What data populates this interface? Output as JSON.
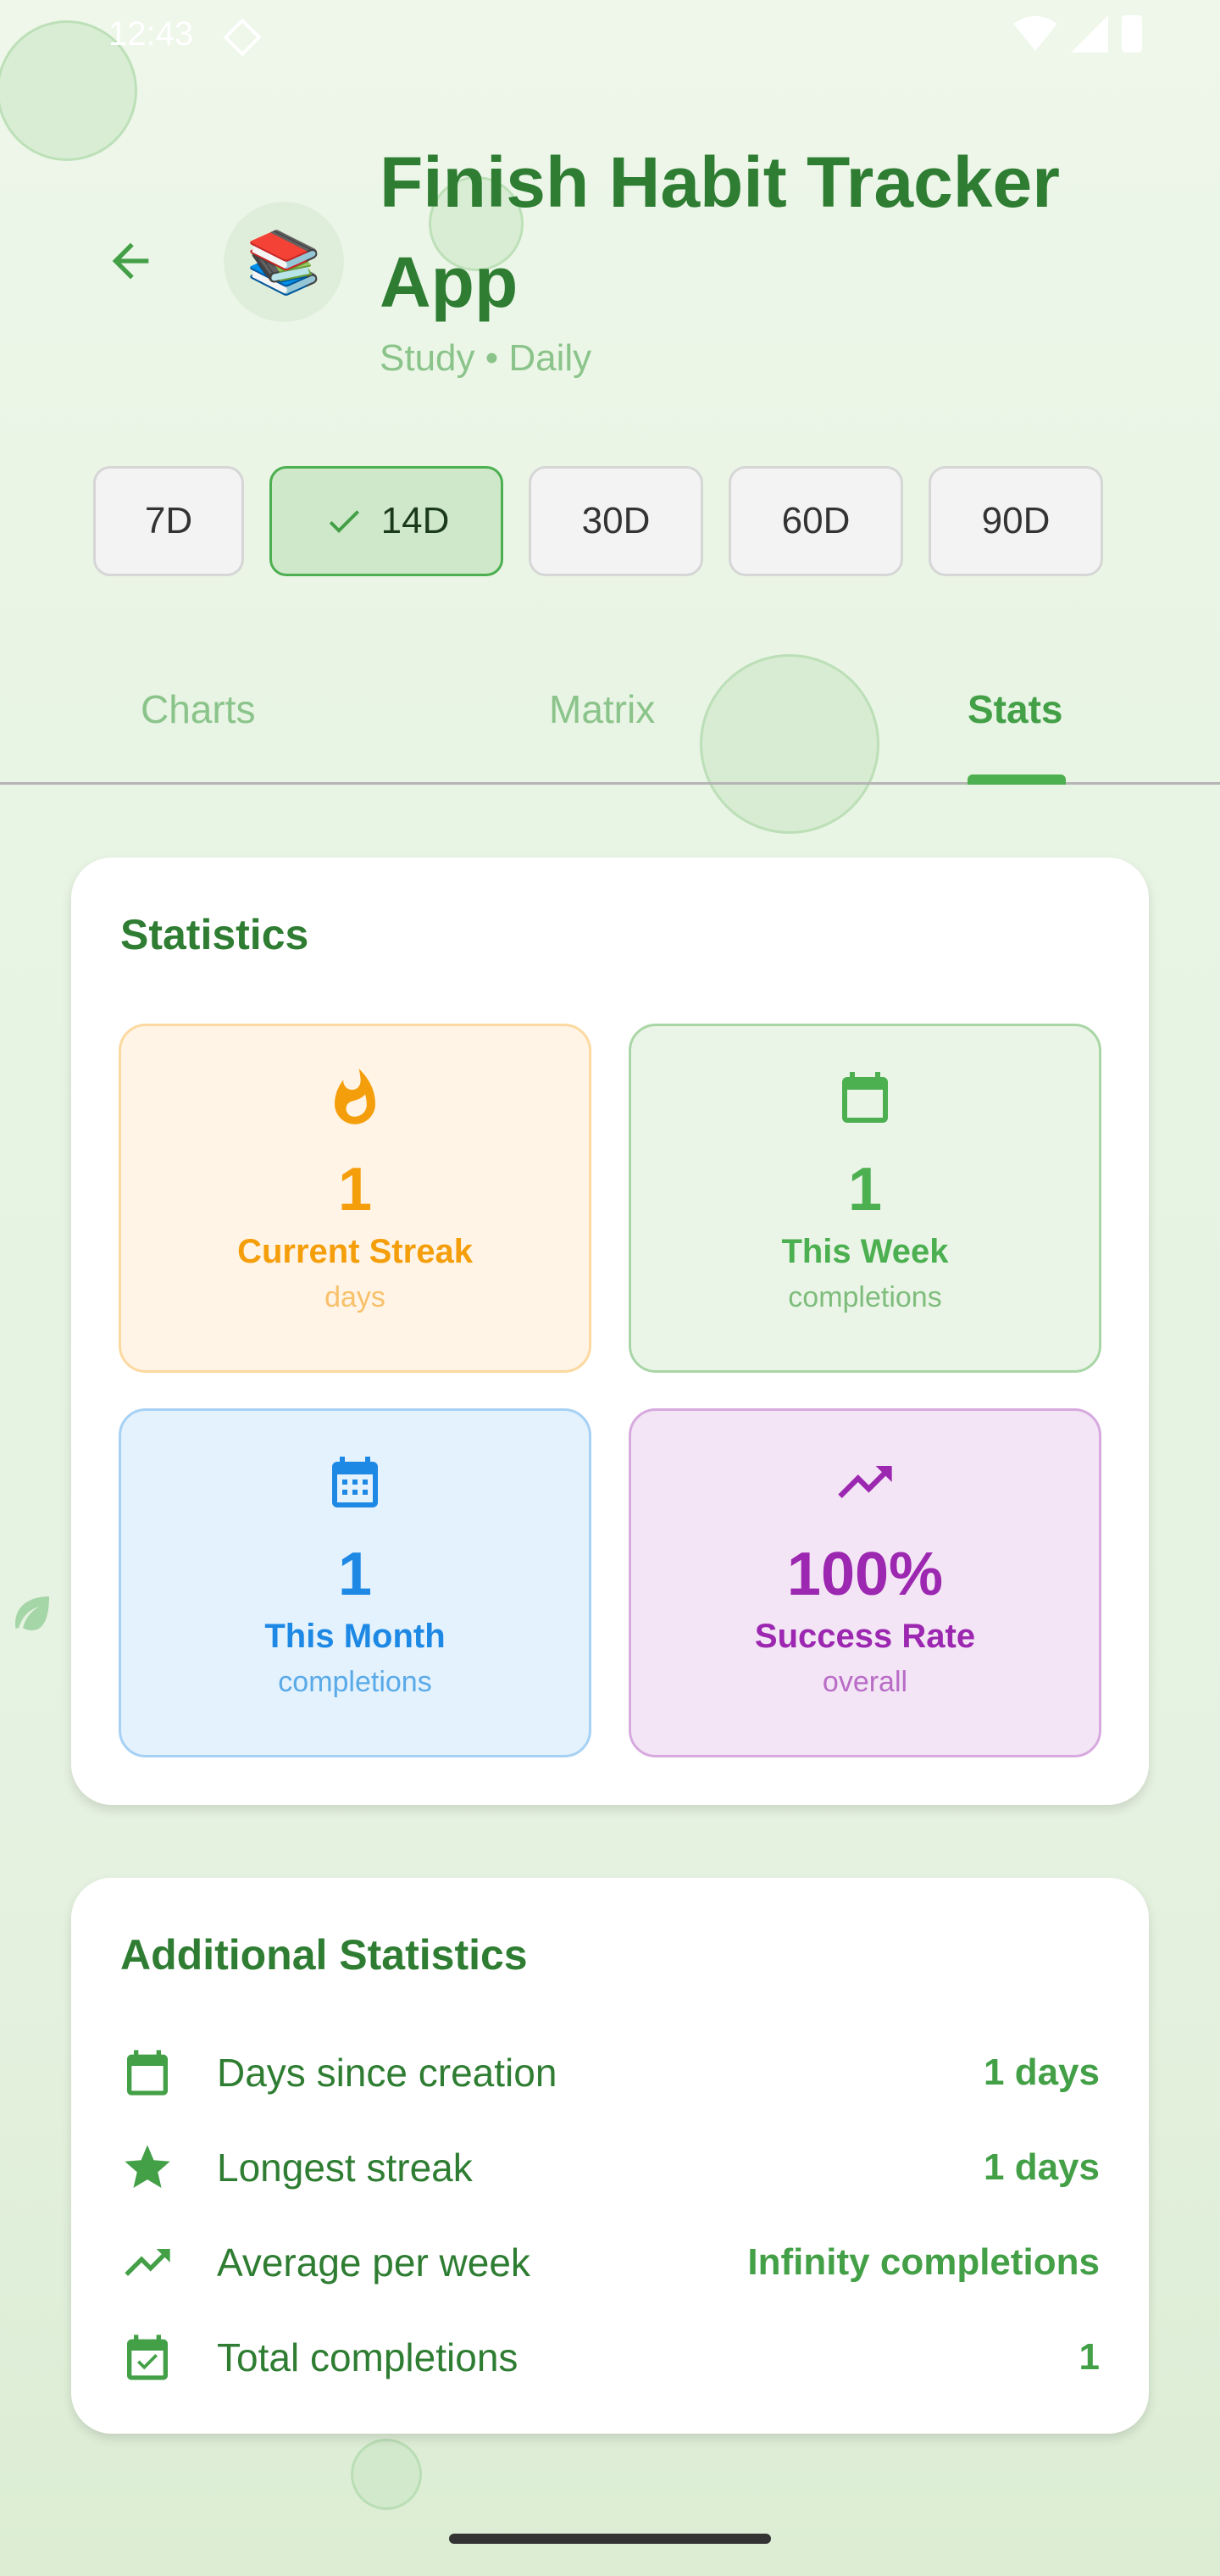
{
  "status_bar": {
    "time": "12:43"
  },
  "header": {
    "habit_emoji": "📚",
    "title": "Finish Habit Tracker App",
    "subtitle": "Study • Daily"
  },
  "ranges": [
    {
      "label": "7D",
      "selected": false
    },
    {
      "label": "14D",
      "selected": true
    },
    {
      "label": "30D",
      "selected": false
    },
    {
      "label": "60D",
      "selected": false
    },
    {
      "label": "90D",
      "selected": false
    }
  ],
  "tabs": [
    {
      "label": "Charts",
      "active": false
    },
    {
      "label": "Matrix",
      "active": false
    },
    {
      "label": "Stats",
      "active": true
    }
  ],
  "statistics": {
    "title": "Statistics",
    "boxes": [
      {
        "icon": "fire-icon",
        "value": "1",
        "label": "Current Streak",
        "sub": "days",
        "color": "#f59e0b"
      },
      {
        "icon": "calendar-icon",
        "value": "1",
        "label": "This Week",
        "sub": "completions",
        "color": "#4caf50"
      },
      {
        "icon": "calendar-month-icon",
        "value": "1",
        "label": "This Month",
        "sub": "completions",
        "color": "#1e88e5"
      },
      {
        "icon": "trending-up-icon",
        "value": "100%",
        "label": "Success Rate",
        "sub": "overall",
        "color": "#9c27b0"
      }
    ]
  },
  "additional": {
    "title": "Additional Statistics",
    "rows": [
      {
        "icon": "calendar-icon",
        "label": "Days since creation",
        "value": "1 days"
      },
      {
        "icon": "star-icon",
        "label": "Longest streak",
        "value": "1 days"
      },
      {
        "icon": "trending-up-icon",
        "label": "Average per week",
        "value": "Infinity completions"
      },
      {
        "icon": "calendar-check-icon",
        "label": "Total completions",
        "value": "1"
      }
    ]
  },
  "colors": {
    "primary": "#2e7d32",
    "accent": "#4caf50",
    "orange": "#f59e0b",
    "blue": "#1e88e5",
    "purple": "#9c27b0"
  }
}
